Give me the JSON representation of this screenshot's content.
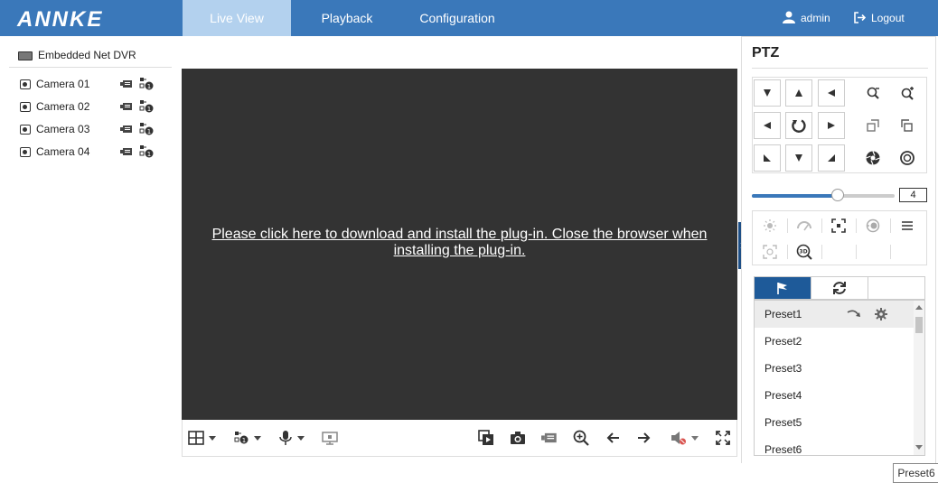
{
  "header": {
    "logo": "ANNKE",
    "tabs": [
      {
        "label": "Live View"
      },
      {
        "label": "Playback"
      },
      {
        "label": "Configuration"
      }
    ],
    "user": "admin",
    "logout": "Logout"
  },
  "device": {
    "title": "Embedded Net DVR",
    "cameras": [
      {
        "label": "Camera 01"
      },
      {
        "label": "Camera 02"
      },
      {
        "label": "Camera 03"
      },
      {
        "label": "Camera 04"
      }
    ]
  },
  "video": {
    "plugin_message": "Please click here to download and install the plug-in. Close the browser when installing the plug-in."
  },
  "ptz": {
    "title": "PTZ",
    "speed_value": "4",
    "speed_fraction": 0.6,
    "presets": [
      {
        "label": "Preset1"
      },
      {
        "label": "Preset2"
      },
      {
        "label": "Preset3"
      },
      {
        "label": "Preset4"
      },
      {
        "label": "Preset5"
      },
      {
        "label": "Preset6"
      }
    ]
  },
  "tooltip": {
    "text": "Preset6"
  },
  "colors": {
    "header_bg": "#3a78ba",
    "active_tab_bg": "#b3d1ee",
    "video_bg": "#333333",
    "accent_dark": "#1e5a99"
  }
}
